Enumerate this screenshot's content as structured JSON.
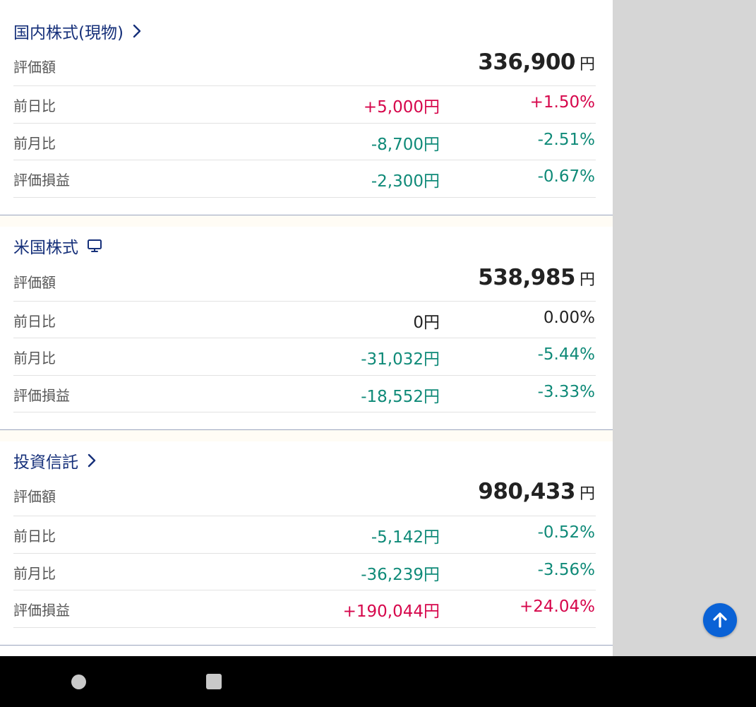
{
  "sections": [
    {
      "title": "国内株式(現物)",
      "title_icon": "chevron-right-icon",
      "valuation_label": "評価額",
      "valuation": "336,900",
      "currency": "円",
      "rows": [
        {
          "label": "前日比",
          "amount": "+5,000円",
          "percent": "+1.50%",
          "sign": "pos"
        },
        {
          "label": "前月比",
          "amount": "-8,700円",
          "percent": "-2.51%",
          "sign": "neg"
        },
        {
          "label": "評価損益",
          "amount": "-2,300円",
          "percent": "-0.67%",
          "sign": "neg"
        }
      ]
    },
    {
      "title": "米国株式",
      "title_icon": "monitor-icon",
      "valuation_label": "評価額",
      "valuation": "538,985",
      "currency": "円",
      "rows": [
        {
          "label": "前日比",
          "amount": "0円",
          "percent": "0.00%",
          "sign": "zero"
        },
        {
          "label": "前月比",
          "amount": "-31,032円",
          "percent": "-5.44%",
          "sign": "neg"
        },
        {
          "label": "評価損益",
          "amount": "-18,552円",
          "percent": "-3.33%",
          "sign": "neg"
        }
      ]
    },
    {
      "title": "投資信託",
      "title_icon": "chevron-right-icon",
      "valuation_label": "評価額",
      "valuation": "980,433",
      "currency": "円",
      "rows": [
        {
          "label": "前日比",
          "amount": "-5,142円",
          "percent": "-0.52%",
          "sign": "neg"
        },
        {
          "label": "前月比",
          "amount": "-36,239円",
          "percent": "-3.56%",
          "sign": "neg"
        },
        {
          "label": "評価損益",
          "amount": "+190,044円",
          "percent": "+24.04%",
          "sign": "pos"
        }
      ]
    }
  ],
  "colors": {
    "positive": "#d6064b",
    "negative": "#0f8a78",
    "title": "#16307a",
    "fab": "#0a62d6"
  },
  "fab_icon": "arrow-up-icon",
  "nav": {
    "home_icon": "circle-home-icon",
    "recents_icon": "square-recents-icon"
  }
}
